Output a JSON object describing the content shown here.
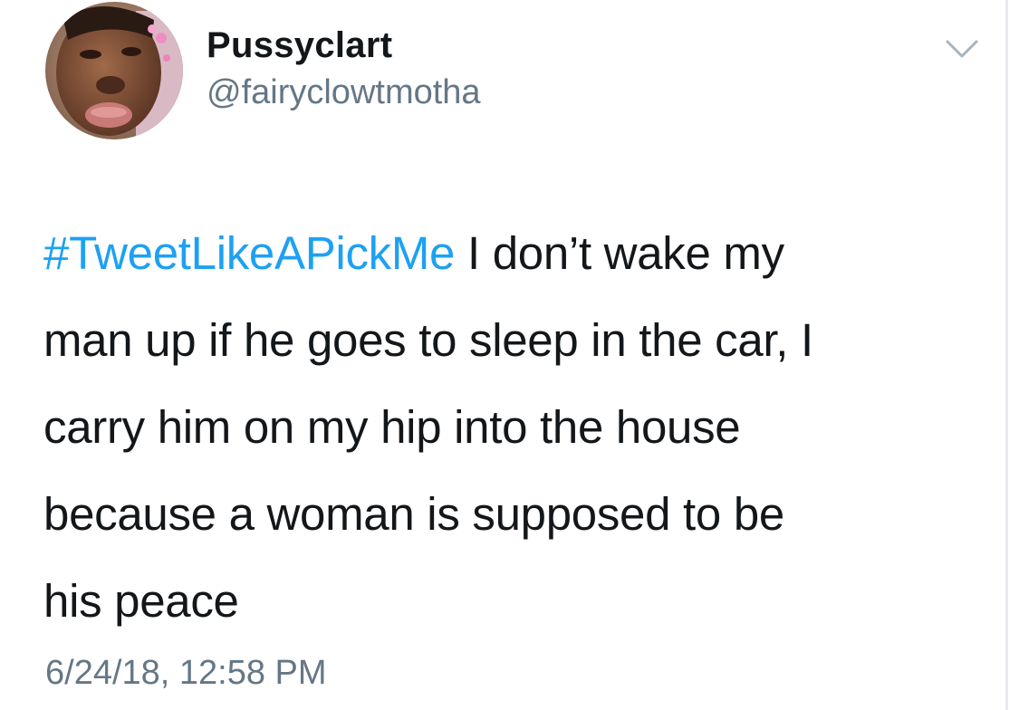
{
  "author": {
    "display_name": "Pussyclart",
    "handle": "@fairyclowtmotha",
    "avatar_icon": "profile-photo"
  },
  "tweet": {
    "hashtag": "#TweetLikeAPickMe",
    "lines": [
      " I don’t wake my",
      "man up if he goes to sleep in the car, I",
      "carry him on my hip into the house",
      "because a woman is supposed to be",
      "his peace"
    ],
    "timestamp": "6/24/18, 12:58 PM"
  },
  "menu": {
    "icon": "chevron-down-icon"
  },
  "colors": {
    "link": "#1da1f2",
    "text": "#14171a",
    "muted": "#657786",
    "divider": "#e6ecf0"
  }
}
